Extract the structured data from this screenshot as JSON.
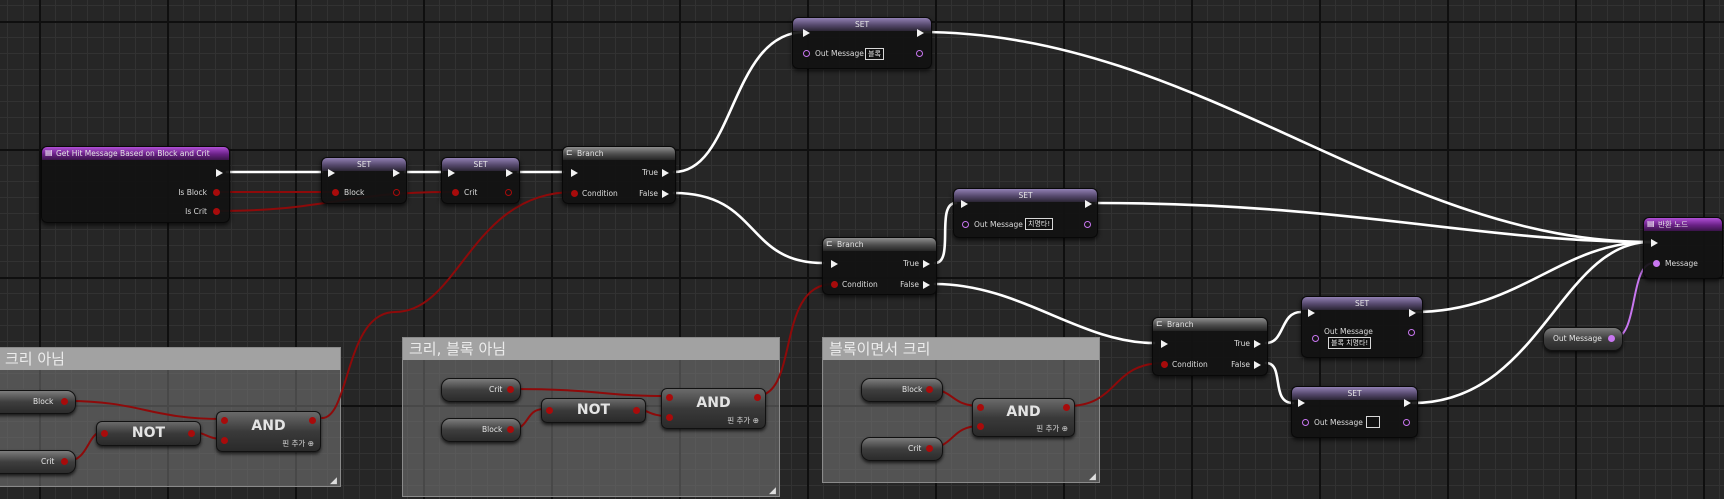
{
  "app": "Unreal Engine Blueprint Editor - Event Graph",
  "comments": {
    "left": "크리 아님",
    "middle": "크리, 블록 아님",
    "right": "블록이면서 크리"
  },
  "func_entry": {
    "title": "Get Hit Message Based on Block and Crit",
    "pin_block": "Is Block",
    "pin_crit": "Is Crit"
  },
  "set_block": {
    "title": "SET",
    "pin": "Block"
  },
  "set_crit": {
    "title": "SET",
    "pin": "Crit"
  },
  "branch1": {
    "title": "Branch",
    "cond": "Condition",
    "true": "True",
    "false": "False"
  },
  "branch2": {
    "title": "Branch",
    "cond": "Condition",
    "true": "True",
    "false": "False"
  },
  "branch3": {
    "title": "Branch",
    "cond": "Condition",
    "true": "True",
    "false": "False"
  },
  "set_top": {
    "title": "SET",
    "pin": "Out Message",
    "value": "블록"
  },
  "set_mid": {
    "title": "SET",
    "pin": "Out Message",
    "value": "치명타!"
  },
  "set_r1": {
    "title": "SET",
    "pin": "Out Message",
    "value": "블록 치명타!"
  },
  "set_r2": {
    "title": "SET",
    "pin": "Out Message",
    "value": ""
  },
  "return_node": {
    "title": "반환 노드",
    "pin": "Message"
  },
  "getter_outmsg": "Out Message",
  "left_group": {
    "block": "Block",
    "crit": "Crit",
    "not": "NOT",
    "and": "AND",
    "add_pin": "핀 추가"
  },
  "mid_group": {
    "crit": "Crit",
    "block": "Block",
    "not": "NOT",
    "and": "AND",
    "add_pin": "핀 추가"
  },
  "right_group": {
    "block": "Block",
    "crit": "Crit",
    "and": "AND",
    "add_pin": "핀 추가"
  },
  "colors": {
    "exec_wire": "#ffffff",
    "bool_wire": "#8e0a0a",
    "string_wire": "#c877f0",
    "func_header": "#8b2cae",
    "set_header": "#7a6a98"
  }
}
